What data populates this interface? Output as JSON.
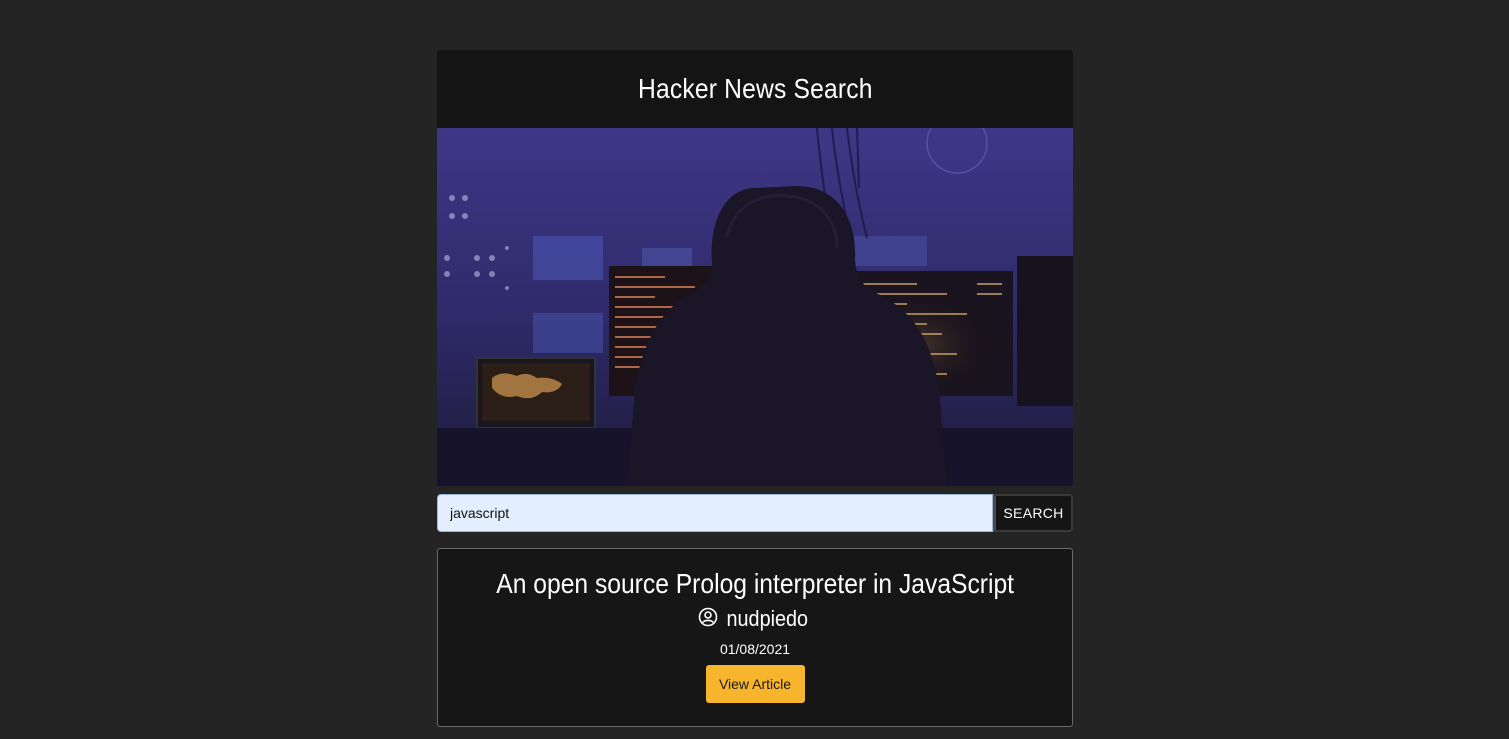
{
  "header": {
    "title": "Hacker News Search"
  },
  "hero": {
    "alt": "hooded hacker at computer monitors",
    "icon": "hacker-banner-image"
  },
  "search": {
    "value": "javascript",
    "placeholder": "",
    "button_label": "SEARCH"
  },
  "results": [
    {
      "title": "An open source Prolog interpreter in JavaScript",
      "author": "nudpiedo",
      "date": "01/08/2021",
      "button_label": "View Article"
    }
  ],
  "colors": {
    "background": "#242424",
    "header": "#141414",
    "accent": "#f6b52c",
    "input_bg": "#e3effe"
  }
}
